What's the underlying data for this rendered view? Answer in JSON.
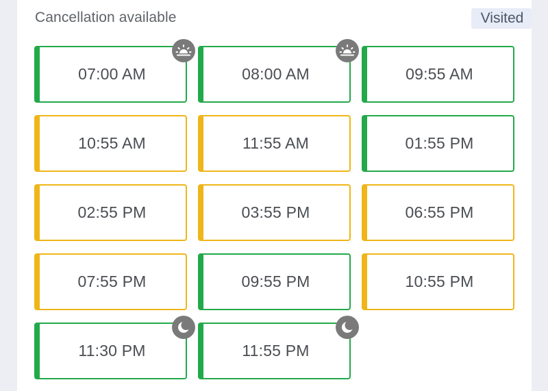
{
  "header": {
    "title": "Cancellation available",
    "visited_label": "Visited"
  },
  "colors": {
    "available": "#22a94a",
    "limited": "#efb519",
    "badge": "#7a7a7a"
  },
  "slots": [
    {
      "time": "07:00 AM",
      "status": "available",
      "icon": "sunrise-icon"
    },
    {
      "time": "08:00 AM",
      "status": "available",
      "icon": "sunrise-icon"
    },
    {
      "time": "09:55 AM",
      "status": "available",
      "icon": null
    },
    {
      "time": "10:55 AM",
      "status": "limited",
      "icon": null
    },
    {
      "time": "11:55 AM",
      "status": "limited",
      "icon": null
    },
    {
      "time": "01:55 PM",
      "status": "available",
      "icon": null
    },
    {
      "time": "02:55 PM",
      "status": "limited",
      "icon": null
    },
    {
      "time": "03:55 PM",
      "status": "limited",
      "icon": null
    },
    {
      "time": "06:55 PM",
      "status": "limited",
      "icon": null
    },
    {
      "time": "07:55 PM",
      "status": "limited",
      "icon": null
    },
    {
      "time": "09:55 PM",
      "status": "available",
      "icon": null
    },
    {
      "time": "10:55 PM",
      "status": "limited",
      "icon": null
    },
    {
      "time": "11:30 PM",
      "status": "available",
      "icon": "moon-icon"
    },
    {
      "time": "11:55 PM",
      "status": "available",
      "icon": "moon-icon"
    }
  ]
}
